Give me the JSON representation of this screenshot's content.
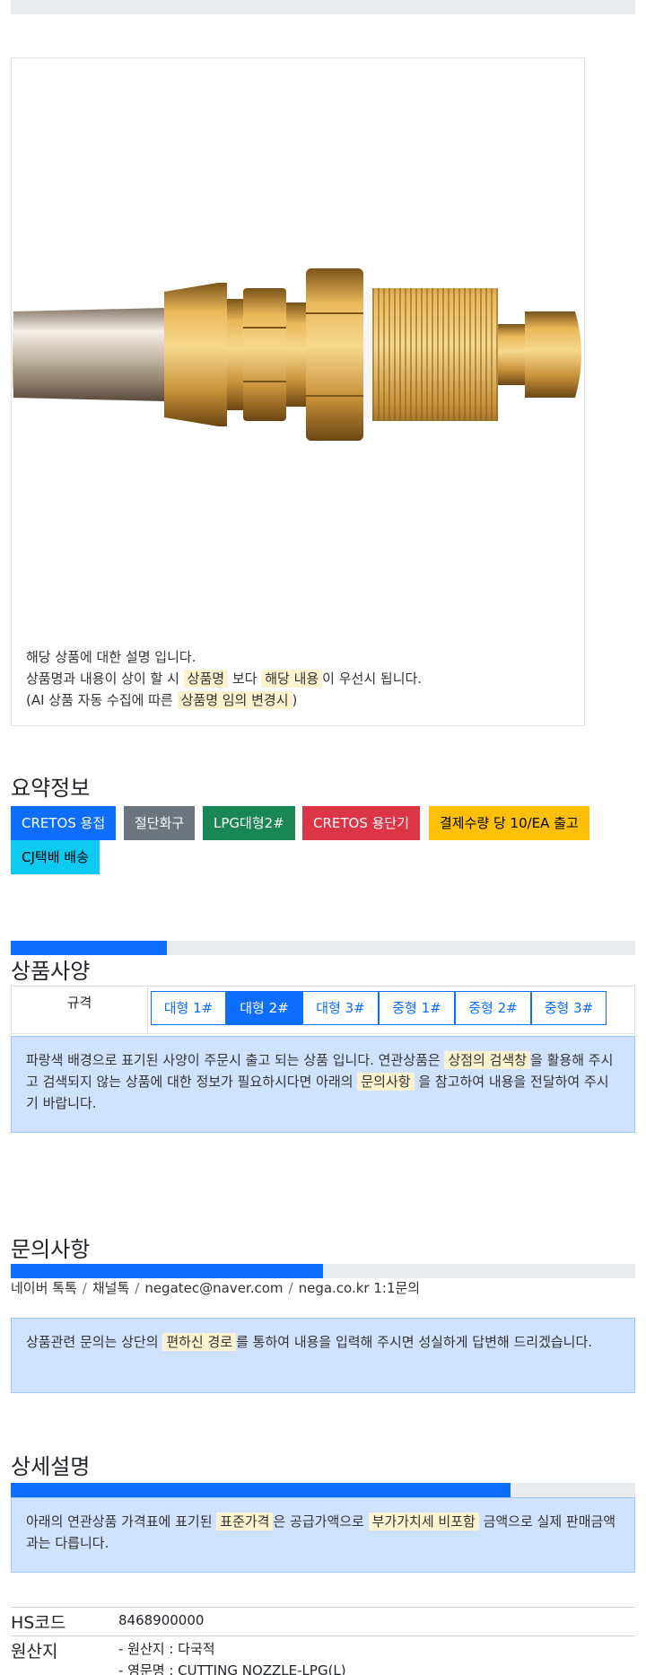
{
  "notice": {
    "line1": "해당 상품에 대한 설명 입니다.",
    "line2_a": "상품명과 내용이 상이 할 시 ",
    "line2_mark1": "상품명",
    "line2_b": " 보다 ",
    "line2_mark2": "해당 내용",
    "line2_c": "이 우선시 됩니다.",
    "line3_a": "(AI 상품 자동 수집에 따른 ",
    "line3_mark": "상품명 임의 변경시",
    "line3_b": ")"
  },
  "summary": {
    "title": "요약정보",
    "badges": [
      {
        "label": "CRETOS 용접",
        "color": "#0d6efd"
      },
      {
        "label": "절단화구",
        "color": "#6c757d"
      },
      {
        "label": "LPG대형2#",
        "color": "#198754"
      },
      {
        "label": "CRETOS 용단기",
        "color": "#dc3545"
      },
      {
        "label": "결제수량 당 10/EA 출고",
        "color": "#ffc107"
      },
      {
        "label": "CJ택배 배송",
        "color": "#0dcaf0"
      }
    ]
  },
  "spec": {
    "title": "상품사양",
    "progress": 0.25,
    "label": "규격",
    "options": [
      "대형 1#",
      "대형 2#",
      "대형 3#",
      "중형 1#",
      "중형 2#",
      "중형 3#"
    ],
    "selected": "대형 2#",
    "info_a": "파랑색 배경으로 표기된 사양이 주문시 출고 되는 상품 입니다. 연관상품은 ",
    "info_mark1": "상점의 검색창",
    "info_b": "을 활용해 주시고 검색되지 않는 상품에 대한 정보가 필요하시다면 아래의 ",
    "info_mark2": "문의사항",
    "info_c": " 을 참고하여 내용을 전달하여 주시기 바랍니다."
  },
  "inquiry": {
    "title": "문의사항",
    "progress": 0.5,
    "channels": [
      "네이버 톡톡",
      "채널톡",
      "negatec@naver.com",
      "nega.co.kr 1:1문의"
    ],
    "info_a": "상품관련 문의는 상단의 ",
    "info_mark": "편하신 경로",
    "info_b": "를 통하여 내용을 입력해 주시면 성실하게 답변해 드리겠습니다."
  },
  "detail": {
    "title": "상세설명",
    "progress": 0.8,
    "info_a": "아래의 연관상품 가격표에 표기된 ",
    "info_mark1": "표준가격",
    "info_b": "은 공급가액으로 ",
    "info_mark2": "부가가치세 비포함",
    "info_c": " 금액으로 실제 판매금액과는 다릅니다.",
    "hs_label": "HS코드",
    "hs_value": "8468900000",
    "origin_label": "원산지",
    "origin_line1": "- 원산지 : 다국적",
    "origin_line2": "- 영문명 : CUTTING NOZZLE-LPG(L)"
  }
}
